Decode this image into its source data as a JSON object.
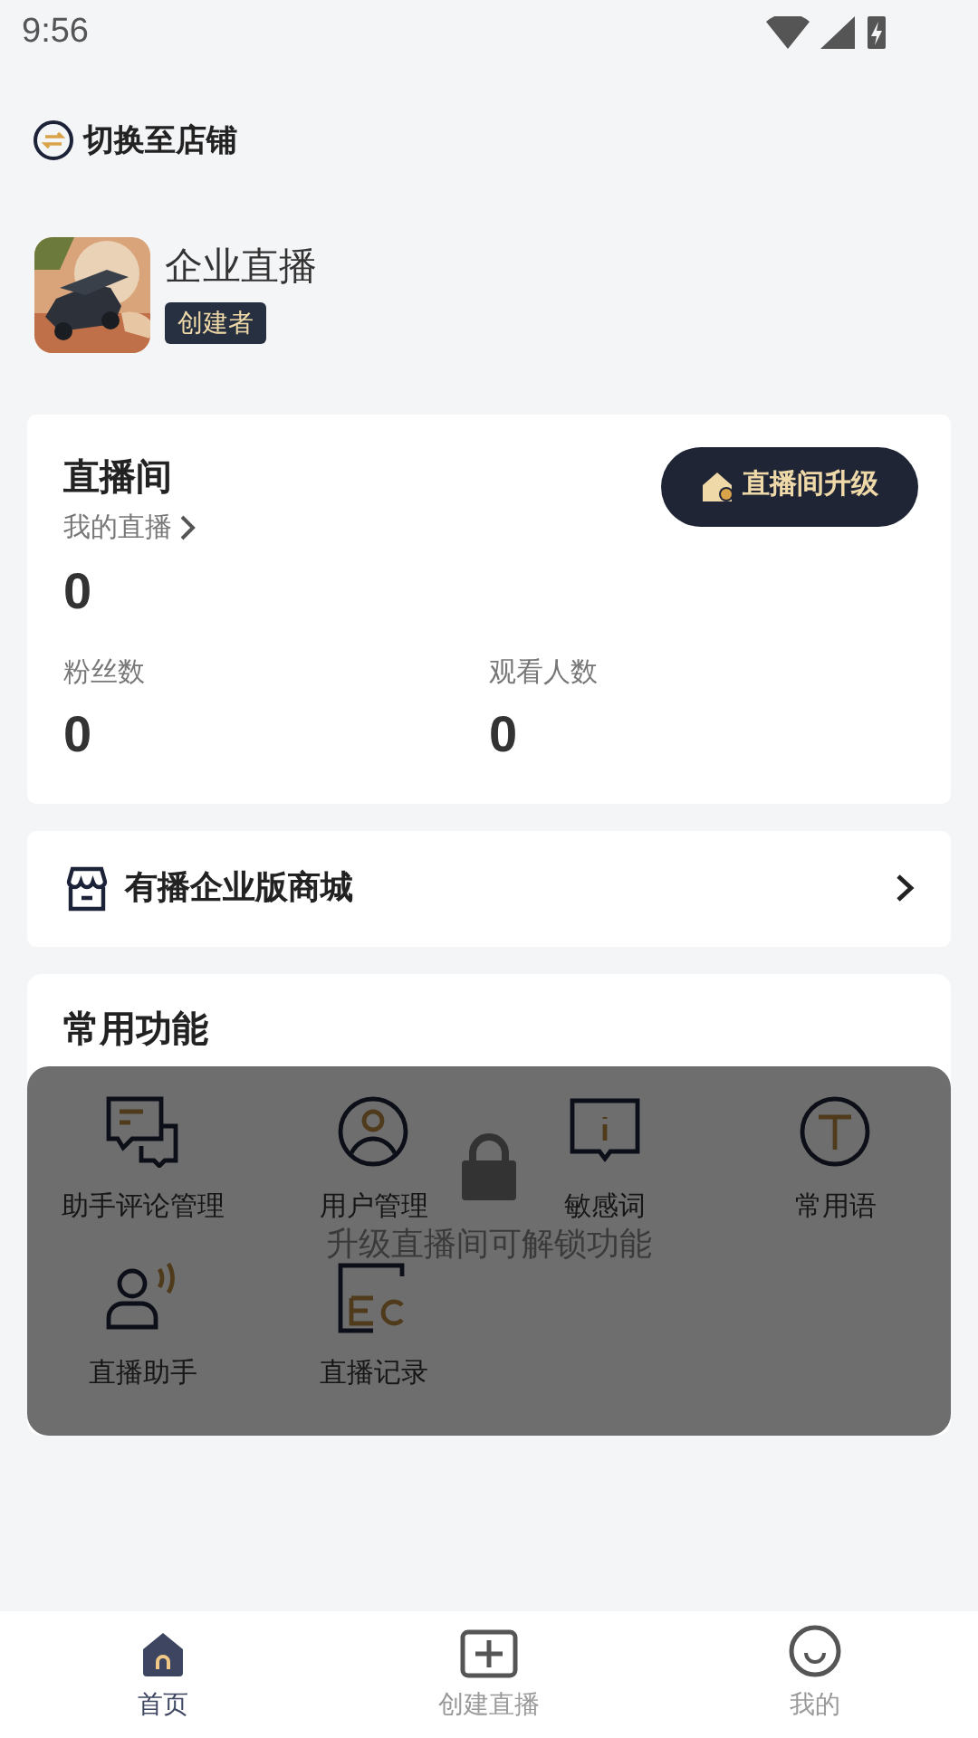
{
  "status_bar": {
    "time": "9:56"
  },
  "switch_store": {
    "label": "切换至店铺"
  },
  "profile": {
    "name": "企业直播",
    "badge": "创建者"
  },
  "live_room": {
    "title": "直播间",
    "upgrade_button": "直播间升级",
    "my_live": {
      "label": "我的直播",
      "value": "0"
    },
    "stats": [
      {
        "label": "粉丝数",
        "value": "0"
      },
      {
        "label": "观看人数",
        "value": "0"
      }
    ]
  },
  "mall": {
    "label": "有播企业版商城"
  },
  "common_functions": {
    "title": "常用功能",
    "locked": true,
    "lock_message": "升级直播间可解锁功能",
    "items": [
      {
        "kind": "comments",
        "label": "助手评论管理"
      },
      {
        "kind": "user",
        "label": "用户管理"
      },
      {
        "kind": "sensitive",
        "label": "敏感词"
      },
      {
        "kind": "phrase",
        "label": "常用语"
      },
      {
        "kind": "assistant",
        "label": "直播助手"
      },
      {
        "kind": "record",
        "label": "直播记录"
      }
    ]
  },
  "bottom_nav": [
    {
      "kind": "home",
      "label": "首页",
      "selected": true
    },
    {
      "kind": "create",
      "label": "创建直播",
      "selected": false
    },
    {
      "kind": "me",
      "label": "我的",
      "selected": false
    }
  ]
}
